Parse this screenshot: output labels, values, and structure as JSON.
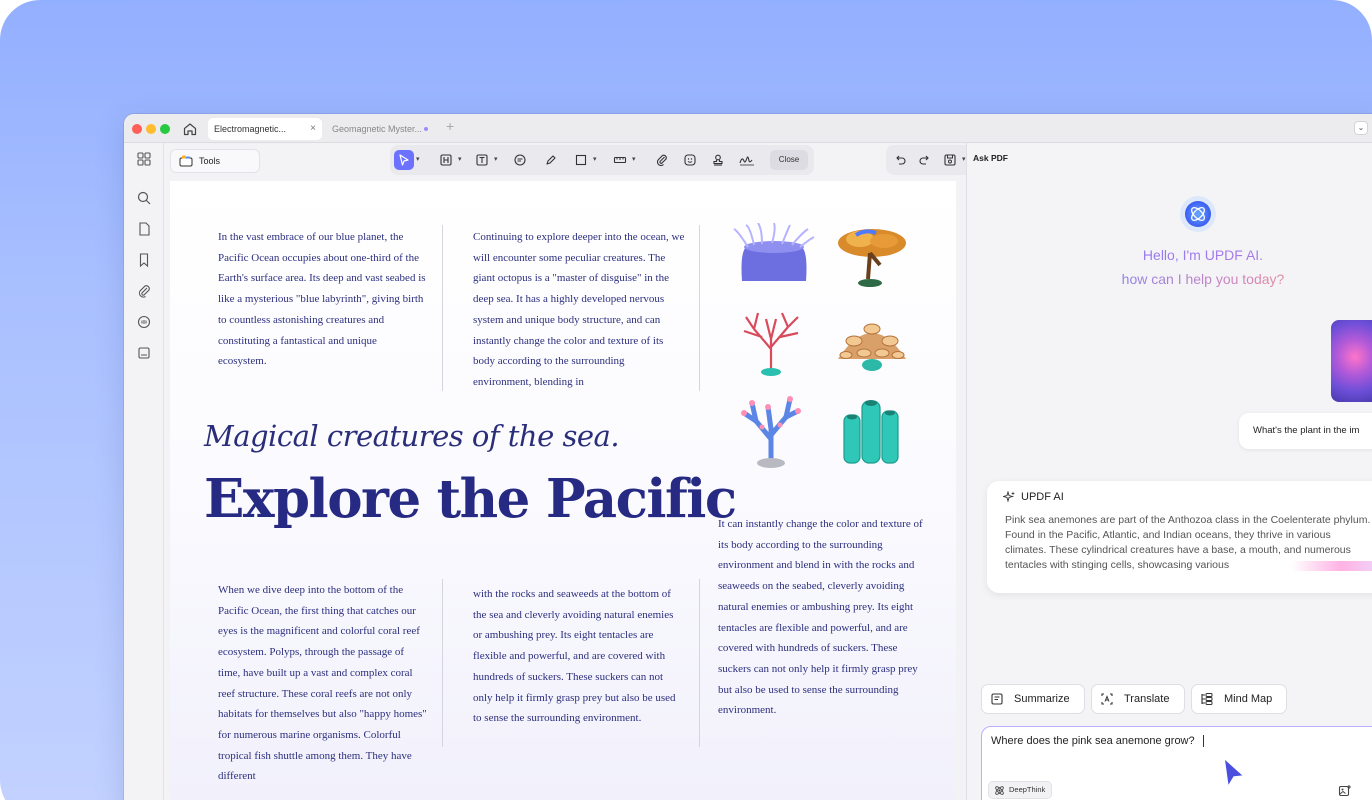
{
  "window": {
    "tabs": [
      {
        "label": "Electromagnetic...",
        "close": "×"
      },
      {
        "label": "Geomagnetic Myster..."
      }
    ],
    "new_tab": "+"
  },
  "toolbar": {
    "tools_label": "Tools",
    "close_label": "Close"
  },
  "document": {
    "col1_top": "In the vast embrace of our blue planet, the Pacific Ocean occupies about one-third of the Earth's surface area. Its deep and vast seabed is like a mysterious \"blue labyrinth\", giving birth to countless astonishing creatures and constituting a fantastical and unique ecosystem.",
    "col2_top": "Continuing to explore deeper into the ocean, we will encounter some peculiar creatures. The giant octopus is a \"master of disguise\" in the deep sea. It has a highly developed nervous system and unique body structure, and can instantly change the color and texture of its body according to the surrounding environment, blending in",
    "subtitle": "Magical creatures of the sea.",
    "title": "Explore the Pacific",
    "col3_mid": "It can instantly change the color and texture of its body according to the surrounding environment and blend in with the rocks and seaweeds on the seabed, cleverly avoiding natural enemies or ambushing prey. Its eight tentacles are flexible and powerful, and are covered with hundreds of suckers. These suckers can not only help it firmly grasp prey but also be used to sense the surrounding environment.",
    "col1_bottom": "When we dive deep into the bottom of the Pacific Ocean, the first thing that catches our eyes is the magnificent and colorful coral reef ecosystem. Polyps, through the passage of time, have built up a vast and complex coral reef structure. These coral reefs are not only habitats for themselves but also \"happy homes\" for numerous marine organisms. Colorful tropical fish shuttle among them. They have different",
    "col2_bottom": "with the rocks and seaweeds at the bottom of the sea and cleverly avoiding natural enemies or ambushing prey. Its eight tentacles are flexible and powerful, and are covered with hundreds of suckers. These suckers can not only help it firmly grasp prey but also be used to sense the surrounding environment."
  },
  "ai_panel": {
    "title": "Ask PDF",
    "greeting_line1": "Hello, I'm UPDF AI.",
    "greeting_line2": "how can I help you today?",
    "user_question": "What's the plant in the im",
    "response_header": "UPDF AI",
    "response_text": "Pink sea anemones are part of the Anthozoa class in the Coelenterate phylum. Found in the Pacific, Atlantic, and Indian oceans, they thrive in various climates. These cylindrical creatures have a base, a mouth, and numerous tentacles with stinging cells, showcasing various",
    "quick_actions": [
      "Summarize",
      "Translate",
      "Mind Map"
    ],
    "input_value": "Where does the pink sea anemone grow?",
    "deepthink_label": "DeepThink"
  },
  "colors": {
    "accent": "#6c72ff",
    "doc_text": "#2c2f7e",
    "background_gradient": "#93afff"
  }
}
